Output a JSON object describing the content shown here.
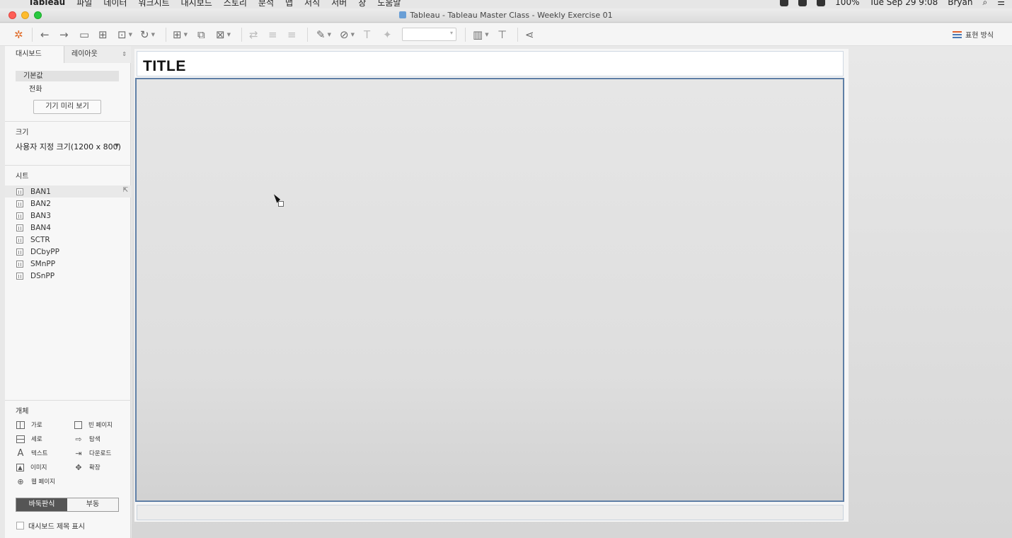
{
  "menubar": {
    "app_name": "Tableau",
    "menus": [
      "파일",
      "데이터",
      "워크시트",
      "대시보드",
      "스토리",
      "분석",
      "맵",
      "서식",
      "서버",
      "창",
      "도움말"
    ],
    "battery": "100%",
    "datetime": "Tue Sep 29  9:08",
    "user": "Bryan"
  },
  "window": {
    "title": "Tableau - Tableau Master Class - Weekly Exercise 01"
  },
  "toolbar": {
    "present_label": "표현 방식"
  },
  "left_panel": {
    "tab_dashboard": "대시보드",
    "tab_layout": "레이아웃",
    "device_default": "기본값",
    "device_phone": "전화",
    "device_preview_btn": "기기 미리 보기",
    "size_label": "크기",
    "size_value": "사용자 지정 크기(1200 x 800)",
    "sheets_label": "시트",
    "sheets": [
      "BAN1",
      "BAN2",
      "BAN3",
      "BAN4",
      "SCTR",
      "DCbyPP",
      "SMnPP",
      "DSnPP"
    ],
    "objects_label": "개체",
    "objects": {
      "horizontal": "가로",
      "blank": "빈 페이지",
      "vertical": "세로",
      "navigation": "탐색",
      "text": "텍스트",
      "download": "다운로드",
      "image": "이미지",
      "extension": "확장",
      "webpage": "웹 페이지"
    },
    "tiled": "바둑판식",
    "floating": "부동",
    "show_title": "대시보드 제목 표시"
  },
  "canvas": {
    "title_text": "TITLE"
  }
}
